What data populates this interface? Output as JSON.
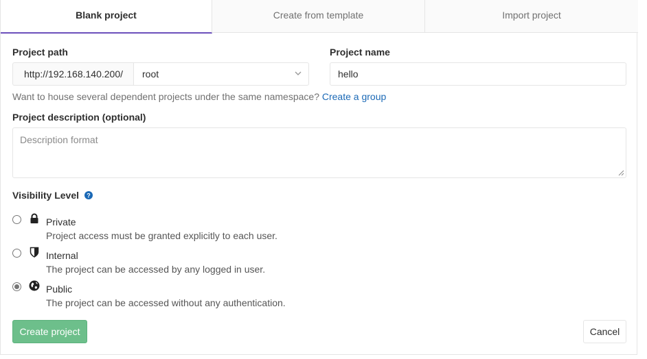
{
  "tabs": [
    {
      "label": "Blank project",
      "active": true
    },
    {
      "label": "Create from template",
      "active": false
    },
    {
      "label": "Import project",
      "active": false
    }
  ],
  "project_path": {
    "label": "Project path",
    "prefix": "http://192.168.140.200/",
    "namespace": "root"
  },
  "project_name": {
    "label": "Project name",
    "value": "hello"
  },
  "namespace_help": {
    "text": "Want to house several dependent projects under the same namespace?",
    "link": "Create a group"
  },
  "description": {
    "label": "Project description (optional)",
    "placeholder": "Description format"
  },
  "visibility": {
    "label": "Visibility Level",
    "options": [
      {
        "title": "Private",
        "description": "Project access must be granted explicitly to each user.",
        "icon": "lock-icon",
        "checked": false
      },
      {
        "title": "Internal",
        "description": "The project can be accessed by any logged in user.",
        "icon": "shield-icon",
        "checked": false
      },
      {
        "title": "Public",
        "description": "The project can be accessed without any authentication.",
        "icon": "globe-icon",
        "checked": true
      }
    ]
  },
  "buttons": {
    "create": "Create project",
    "cancel": "Cancel"
  },
  "colors": {
    "active_tab_border": "#6b4fbb",
    "link": "#1b69b6",
    "create_button": "#6dbf8b"
  }
}
